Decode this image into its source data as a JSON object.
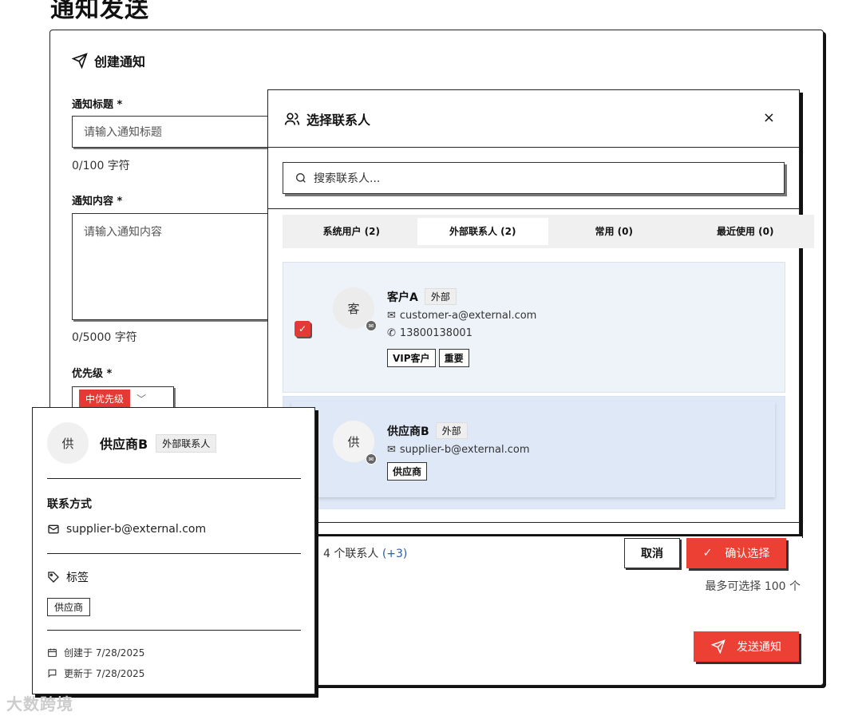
{
  "page": {
    "title": "通知发送"
  },
  "form": {
    "header": "创建通知",
    "title_label": "通知标题 *",
    "title_placeholder": "请输入通知标题",
    "title_count": "0/100 字符",
    "content_label": "通知内容 *",
    "content_placeholder": "请输入通知内容",
    "content_count": "0/5000 字符",
    "priority_label": "优先级 *",
    "priority_value": "中优先级",
    "limit_hint": "最多可选择 100 个",
    "send_label": "发送通知"
  },
  "dialog": {
    "title": "选择联系人",
    "close": "×",
    "search_placeholder": "搜索联系人...",
    "tabs": [
      {
        "label": "系统用户 (2)",
        "active": false
      },
      {
        "label": "外部联系人 (2)",
        "active": true
      },
      {
        "label": "常用 (0)",
        "active": false
      },
      {
        "label": "最近使用 (0)",
        "active": false
      }
    ],
    "contacts": [
      {
        "avatar": "客",
        "name": "客户A",
        "type": "外部",
        "email": "customer-a@external.com",
        "phone": "13800138001",
        "tags": [
          "VIP客户",
          "重要"
        ],
        "checked": true
      },
      {
        "avatar": "供",
        "name": "供应商B",
        "type": "外部",
        "email": "supplier-b@external.com",
        "tags": [
          "供应商"
        ],
        "checked": false
      }
    ],
    "selected_text": "4 个联系人",
    "selected_extra": "(+3)",
    "cancel": "取消",
    "confirm": "确认选择"
  },
  "popover": {
    "avatar": "供",
    "name": "供应商B",
    "chip": "外部联系人",
    "contact_section": "联系方式",
    "email": "supplier-b@external.com",
    "tags_section": "标签",
    "tag": "供应商",
    "created": "创建于 7/28/2025",
    "updated": "更新于 7/28/2025"
  },
  "watermark": "大数跨境",
  "colors": {
    "accent": "#ec4034",
    "selected_row": "#dfe8f7",
    "link": "#2a5db0"
  }
}
